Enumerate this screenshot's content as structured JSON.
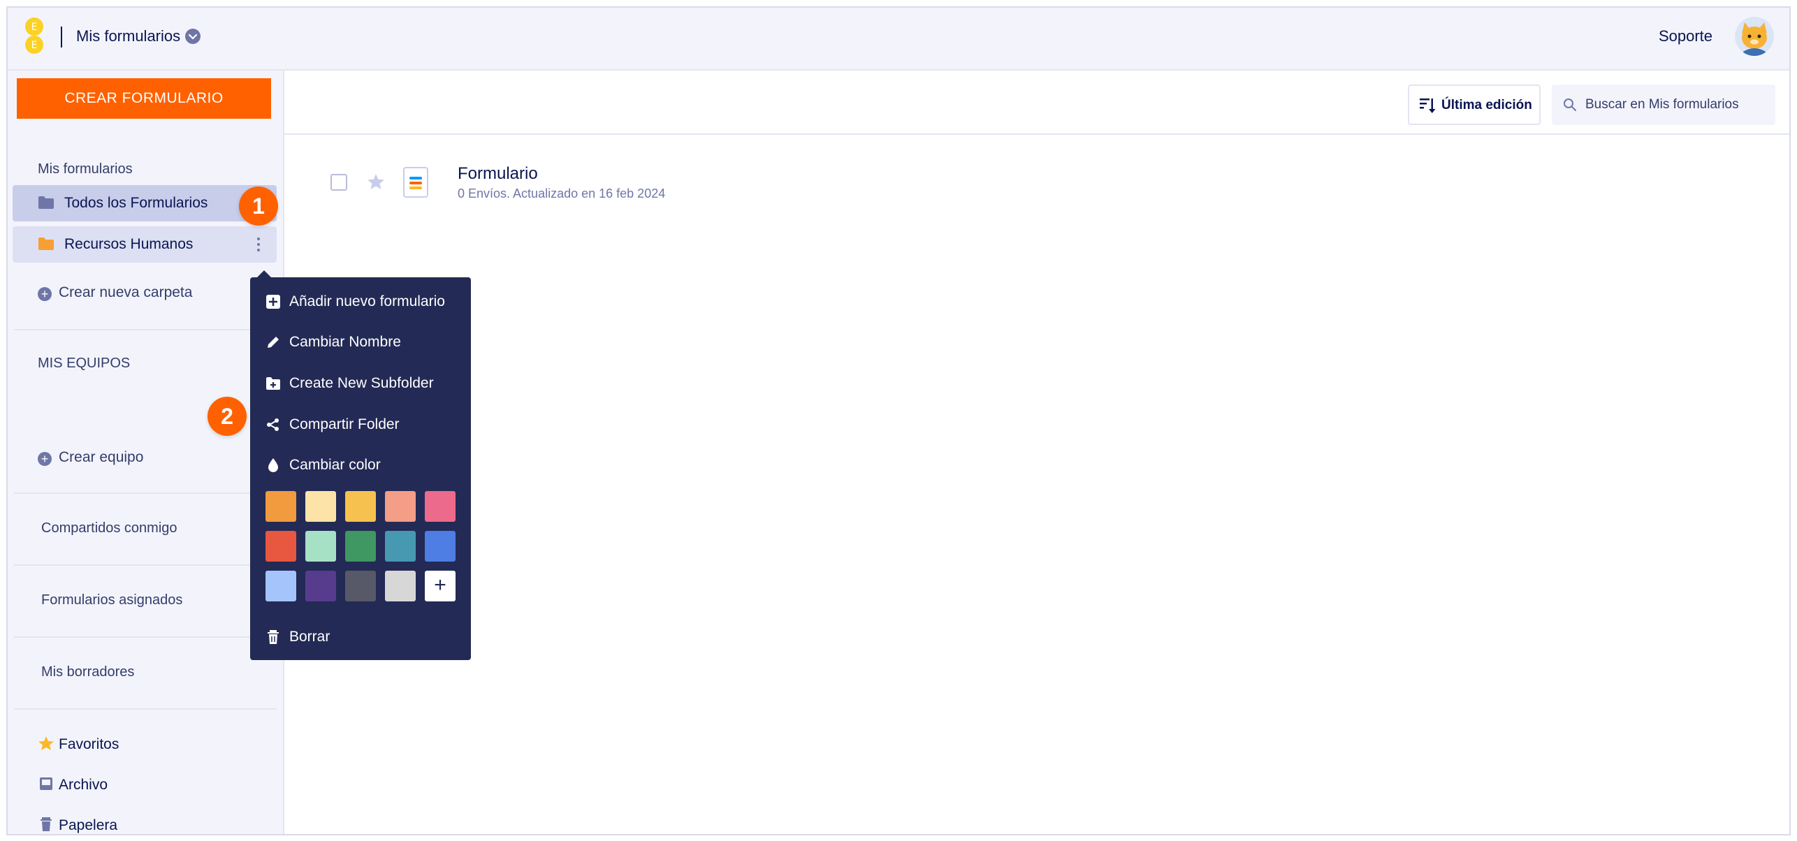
{
  "header": {
    "title": "Mis formularios",
    "support_label": "Soporte"
  },
  "sidebar": {
    "create_button": "CREAR FORMULARIO",
    "my_forms_label": "Mis formularios",
    "folders": [
      {
        "label": "Todos los Formularios",
        "color": "#6f76a7"
      },
      {
        "label": "Recursos Humanos",
        "color": "#f79f33"
      }
    ],
    "new_folder_label": "Crear nueva carpeta",
    "teams_label": "MIS EQUIPOS",
    "create_team_label": "Crear equipo",
    "nav": [
      "Compartidos conmigo",
      "Formularios asignados",
      "Mis borradores"
    ],
    "bottom": [
      "Favoritos",
      "Archivo",
      "Papelera"
    ]
  },
  "badges": [
    "1",
    "2"
  ],
  "toolbar": {
    "sort_label": "Última edición",
    "search_placeholder": "Buscar en Mis formularios"
  },
  "forms": [
    {
      "title": "Formulario",
      "meta": "0 Envíos. Actualizado en 16 feb 2024"
    }
  ],
  "context_menu": {
    "items": [
      "Añadir nuevo formulario",
      "Cambiar Nombre",
      "Create New Subfolder",
      "Compartir Folder",
      "Cambiar color"
    ],
    "delete_label": "Borrar",
    "swatches": [
      "#f19a3e",
      "#fde3a7",
      "#f7c14f",
      "#f49d87",
      "#ec6a8c",
      "#e8573f",
      "#a6e1c5",
      "#3f9761",
      "#4799b1",
      "#4e7de3",
      "#a4c4fb",
      "#573c8e",
      "#585968",
      "#d7d7d7"
    ],
    "custom_color_label": "+"
  }
}
